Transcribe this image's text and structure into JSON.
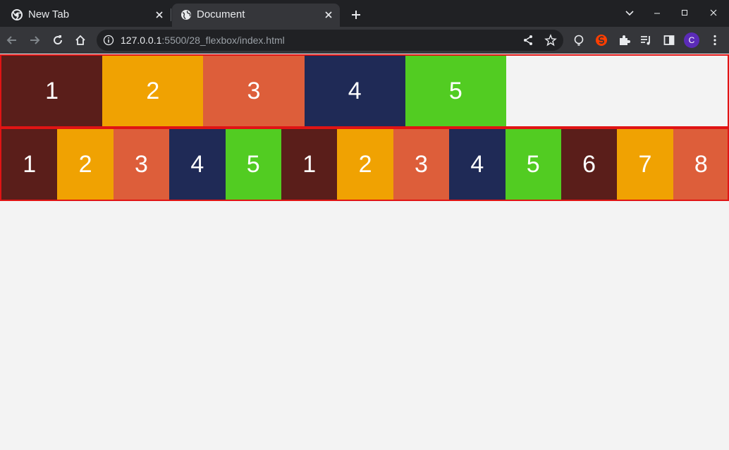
{
  "browser": {
    "tabs": [
      {
        "title": "New Tab",
        "icon": "chrome-icon",
        "active": false
      },
      {
        "title": "Document",
        "icon": "globe-icon",
        "active": true
      }
    ],
    "address": {
      "host": "127.0.0.1",
      "path": ":5500/28_flexbox/index.html"
    },
    "profile_initial": "C"
  },
  "colors": {
    "border": "#e01414",
    "page_bg": "#f3f3f3",
    "box_palette": [
      "#5a1e1a",
      "#f0a202",
      "#dd5e3a",
      "#1f2a56",
      "#52cc22"
    ]
  },
  "container1": {
    "items": [
      {
        "label": "1",
        "color": "#5a1e1a"
      },
      {
        "label": "2",
        "color": "#f0a202"
      },
      {
        "label": "3",
        "color": "#dd5e3a"
      },
      {
        "label": "4",
        "color": "#1f2a56"
      },
      {
        "label": "5",
        "color": "#52cc22"
      }
    ]
  },
  "container2": {
    "items": [
      {
        "label": "1",
        "color": "#5a1e1a"
      },
      {
        "label": "2",
        "color": "#f0a202"
      },
      {
        "label": "3",
        "color": "#dd5e3a"
      },
      {
        "label": "4",
        "color": "#1f2a56"
      },
      {
        "label": "5",
        "color": "#52cc22"
      },
      {
        "label": "1",
        "color": "#5a1e1a"
      },
      {
        "label": "2",
        "color": "#f0a202"
      },
      {
        "label": "3",
        "color": "#dd5e3a"
      },
      {
        "label": "4",
        "color": "#1f2a56"
      },
      {
        "label": "5",
        "color": "#52cc22"
      },
      {
        "label": "6",
        "color": "#5a1e1a"
      },
      {
        "label": "7",
        "color": "#f0a202"
      },
      {
        "label": "8",
        "color": "#dd5e3a"
      },
      {
        "label": "",
        "color": "#1f2a56"
      }
    ]
  }
}
